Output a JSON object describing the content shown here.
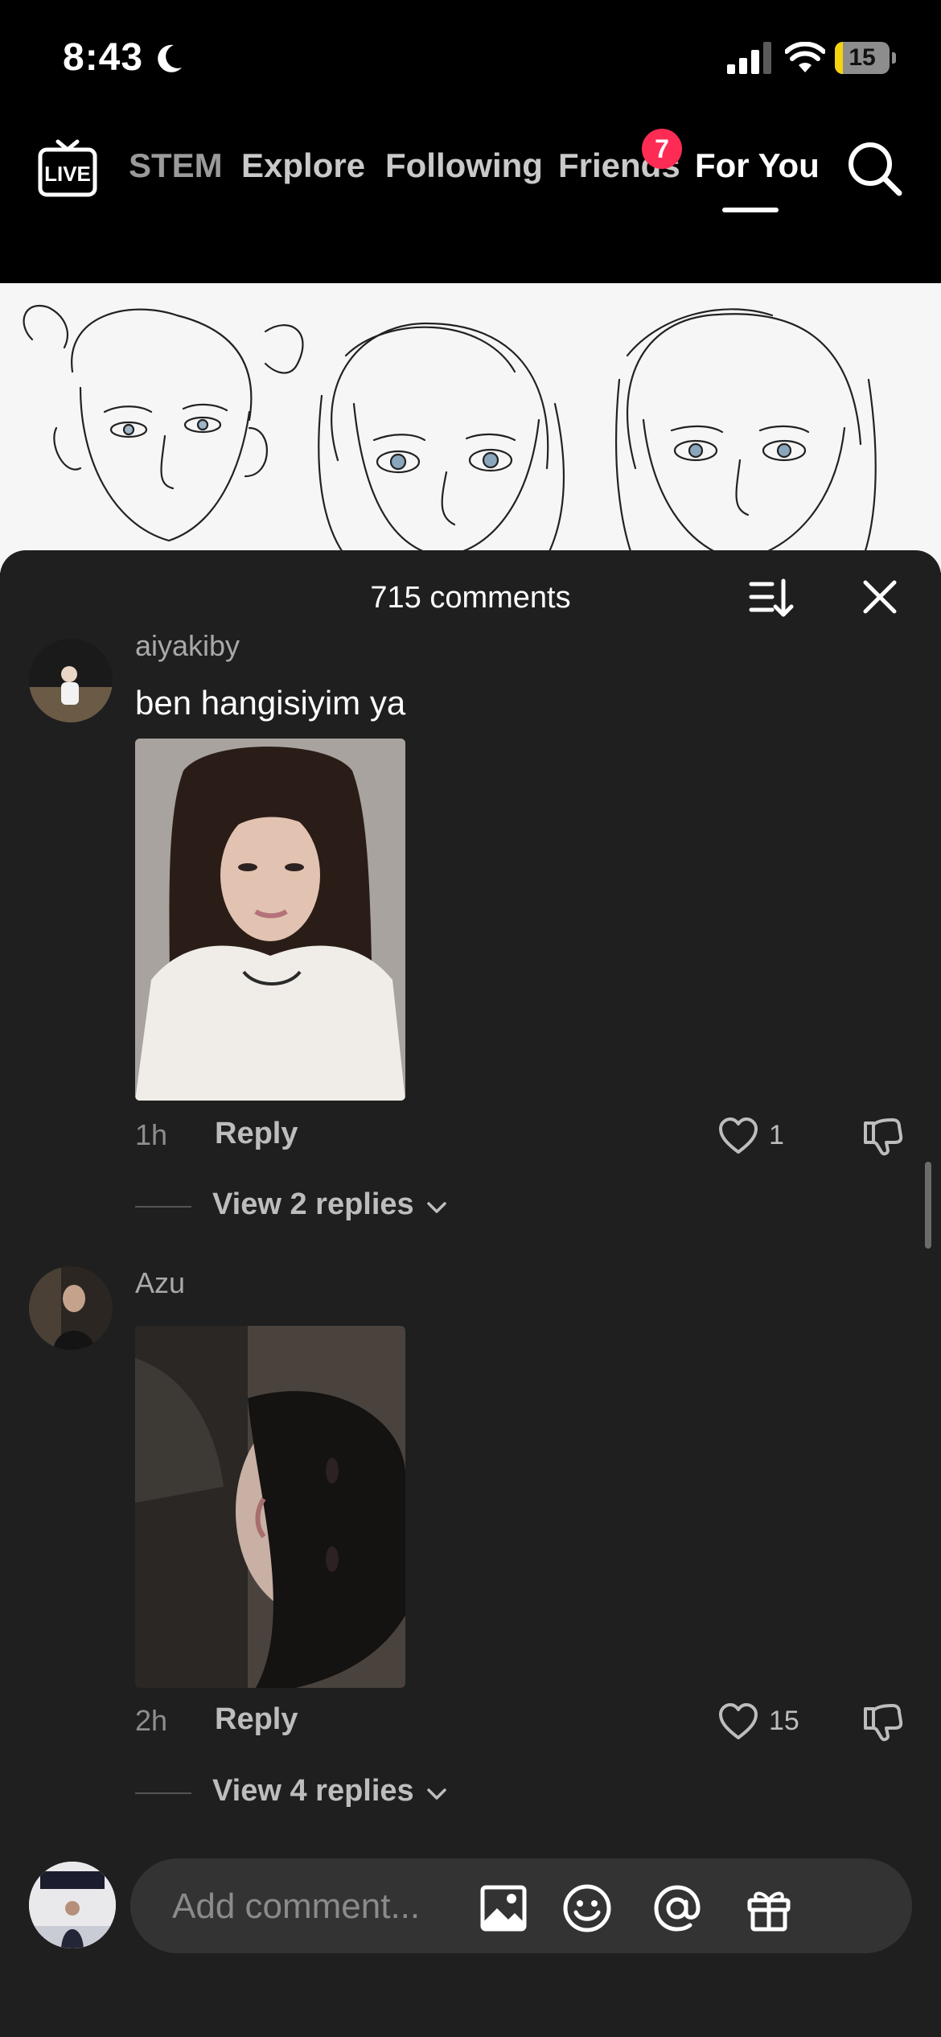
{
  "status": {
    "time": "8:43",
    "battery": "15",
    "battery_level": 0.15
  },
  "nav": {
    "tabs": [
      {
        "label": "STEM"
      },
      {
        "label": "Explore"
      },
      {
        "label": "Following"
      },
      {
        "label": "Friends"
      },
      {
        "label": "For You"
      }
    ],
    "live_label": "LIVE",
    "friends_badge": "7",
    "active_tab": "For You"
  },
  "sheet": {
    "title": "715 comments"
  },
  "comments": [
    {
      "username": "aiyakiby",
      "text": "ben hangisiyim ya",
      "time": "1h",
      "reply_label": "Reply",
      "likes": "1",
      "view_replies": "View 2 replies"
    },
    {
      "username": "Azu",
      "time": "2h",
      "reply_label": "Reply",
      "likes": "15",
      "view_replies": "View 4 replies"
    }
  ],
  "input": {
    "placeholder": "Add comment..."
  },
  "colors": {
    "accent": "#fe2c55",
    "sheet_bg": "#1f1f1f",
    "battery_yellow": "#f5d30f"
  },
  "icons": [
    "moon-icon",
    "signal-icon",
    "wifi-icon",
    "live-tv-icon",
    "search-icon",
    "sort-icon",
    "close-icon",
    "heart-icon",
    "dislike-icon",
    "chevron-down-icon",
    "image-icon",
    "emoji-icon",
    "mention-icon",
    "gift-icon"
  ]
}
